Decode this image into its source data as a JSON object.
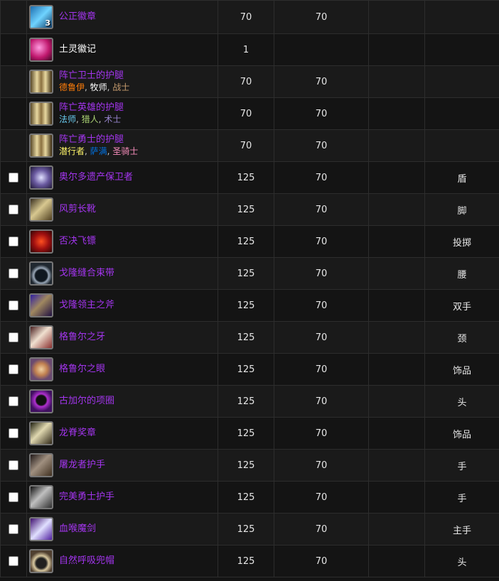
{
  "colors": {
    "epic": "#a335ee",
    "text": "#e6e6e6",
    "row_odd": "#1a1a1a",
    "row_even": "#141414",
    "border": "#2d2d2d"
  },
  "rows": [
    {
      "icon": "badge-of-justice-icon",
      "icon_bg": "linear-gradient(135deg,#1e6fb0,#6fd3ff 50%,#0d3a66)",
      "badge": "3",
      "name": "公正徽章",
      "cost": "70",
      "level": "70",
      "slot": "",
      "checkbox": false,
      "plain": false
    },
    {
      "icon": "earth-mark-icon",
      "icon_bg": "radial-gradient(circle at 40% 40%,#ff9ae0,#c0186e 55%,#3a0822)",
      "name": "土灵徽记",
      "cost": "1",
      "level": "",
      "slot": "",
      "checkbox": false,
      "plain": true
    },
    {
      "icon": "leggings-icon",
      "icon_bg": "linear-gradient(90deg,#5a4a2a,#e8d8a0 30%,#8a7040 50%,#e8d8a0 70%,#3a2a10)",
      "name": "阵亡卫士的护腿",
      "classes": [
        {
          "label": "德鲁伊",
          "cls": "druid"
        },
        {
          "label": "牧师",
          "cls": "priest"
        },
        {
          "label": "战士",
          "cls": "warrior"
        }
      ],
      "cost": "70",
      "level": "70",
      "slot": "",
      "checkbox": false
    },
    {
      "icon": "leggings-icon",
      "icon_bg": "linear-gradient(90deg,#5a4a2a,#e8d8a0 30%,#8a7040 50%,#e8d8a0 70%,#3a2a10)",
      "name": "阵亡英雄的护腿",
      "classes": [
        {
          "label": "法师",
          "cls": "mage"
        },
        {
          "label": "猎人",
          "cls": "hunter"
        },
        {
          "label": "术士",
          "cls": "warlock"
        }
      ],
      "cost": "70",
      "level": "70",
      "slot": "",
      "checkbox": false
    },
    {
      "icon": "leggings-icon",
      "icon_bg": "linear-gradient(90deg,#5a4a2a,#e8d8a0 30%,#8a7040 50%,#e8d8a0 70%,#3a2a10)",
      "name": "阵亡勇士的护腿",
      "classes": [
        {
          "label": "潜行者",
          "cls": "rogue"
        },
        {
          "label": "萨满",
          "cls": "shaman"
        },
        {
          "label": "圣骑士",
          "cls": "paladin"
        }
      ],
      "cost": "70",
      "level": "70",
      "slot": "",
      "checkbox": false
    },
    {
      "icon": "shield-icon",
      "icon_bg": "radial-gradient(circle,#e0e0ff,#6a5aa0 50%,#201838)",
      "name": "奥尔多遗产保卫者",
      "cost": "125",
      "level": "70",
      "slot": "盾",
      "checkbox": true
    },
    {
      "icon": "boots-icon",
      "icon_bg": "linear-gradient(135deg,#3a3020,#d8c890 45%,#504020)",
      "name": "风剪长靴",
      "cost": "125",
      "level": "70",
      "slot": "脚",
      "checkbox": true
    },
    {
      "icon": "throwing-icon",
      "icon_bg": "radial-gradient(circle,#ff5020,#a01010 50%,#300404)",
      "name": "否决飞镖",
      "cost": "125",
      "level": "70",
      "slot": "投掷",
      "checkbox": true
    },
    {
      "icon": "belt-icon",
      "icon_bg": "radial-gradient(circle at 50% 60%,#101820 35%,#9aa8b8 45%,#202830 65%)",
      "name": "戈隆缝合束带",
      "cost": "125",
      "level": "70",
      "slot": "腰",
      "checkbox": true
    },
    {
      "icon": "axe-icon",
      "icon_bg": "linear-gradient(135deg,#3020a0,#a08860 45%,#201040)",
      "name": "戈隆领主之斧",
      "cost": "125",
      "level": "70",
      "slot": "双手",
      "checkbox": true
    },
    {
      "icon": "fang-icon",
      "icon_bg": "linear-gradient(135deg,#4a2020,#f0e0d0 45%,#8a3030)",
      "name": "格鲁尔之牙",
      "cost": "125",
      "level": "70",
      "slot": "颈",
      "checkbox": true
    },
    {
      "icon": "eye-icon",
      "icon_bg": "radial-gradient(circle,#f0d0a0,#c08050 40%,#6a4a70 70%)",
      "name": "格鲁尔之眼",
      "cost": "125",
      "level": "70",
      "slot": "饰品",
      "checkbox": true
    },
    {
      "icon": "necklace-icon",
      "icon_bg": "radial-gradient(circle at 50% 45%,#101010 30%,#b030d0 40%,#401060 70%)",
      "name": "古加尔的项圈",
      "cost": "125",
      "level": "70",
      "slot": "头",
      "checkbox": true
    },
    {
      "icon": "spine-icon",
      "icon_bg": "linear-gradient(135deg,#202010,#e0d8b0 45%,#302818)",
      "name": "龙脊奖章",
      "cost": "125",
      "level": "70",
      "slot": "饰品",
      "checkbox": true
    },
    {
      "icon": "gauntlet-icon",
      "icon_bg": "linear-gradient(135deg,#201818,#a09080 45%,#403020)",
      "name": "屠龙者护手",
      "cost": "125",
      "level": "70",
      "slot": "手",
      "checkbox": true
    },
    {
      "icon": "gauntlet-icon",
      "icon_bg": "linear-gradient(135deg,#101010,#c0c0c0 45%,#303030)",
      "name": "完美勇士护手",
      "cost": "125",
      "level": "70",
      "slot": "手",
      "checkbox": true
    },
    {
      "icon": "sword-icon",
      "icon_bg": "linear-gradient(135deg,#401070,#e0e0ff 50%,#5020a0)",
      "name": "血喉魔剑",
      "cost": "125",
      "level": "70",
      "slot": "主手",
      "checkbox": true
    },
    {
      "icon": "helmet-icon",
      "icon_bg": "radial-gradient(circle at 50% 60%,#202020 30%,#d8c8a0 45%,#504030 70%)",
      "name": "自然呼吸兜帽",
      "cost": "125",
      "level": "70",
      "slot": "头",
      "checkbox": true
    }
  ]
}
